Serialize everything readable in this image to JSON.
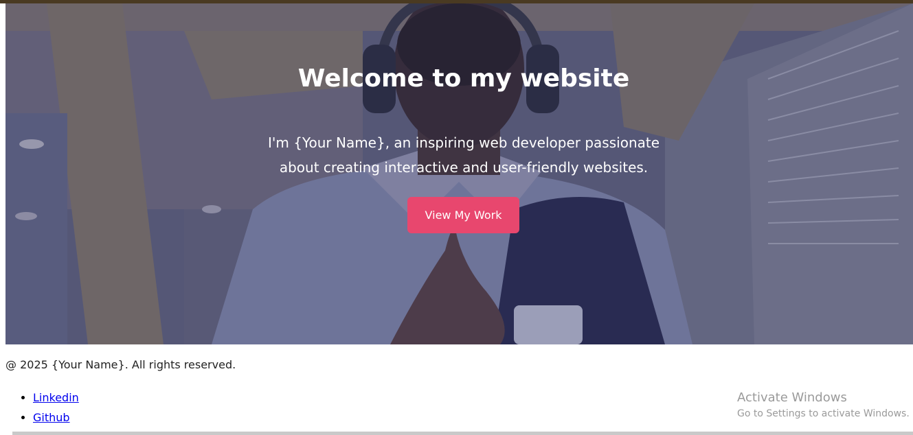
{
  "hero": {
    "title": "Welcome to my website",
    "subtitle": "I'm {Your Name}, an inspiring web developer passionate about creating interactive and user-friendly websites.",
    "cta_label": "View My Work",
    "background_description_icon": "portrait-photo",
    "cta_color": "#e8476e"
  },
  "footer": {
    "copyright": "@ 2025 {Your Name}. All rights reserved.",
    "links": [
      {
        "label": "Linkedin"
      },
      {
        "label": "Github"
      }
    ]
  },
  "os_watermark": {
    "title": "Activate Windows",
    "subtitle": "Go to Settings to activate Windows."
  }
}
